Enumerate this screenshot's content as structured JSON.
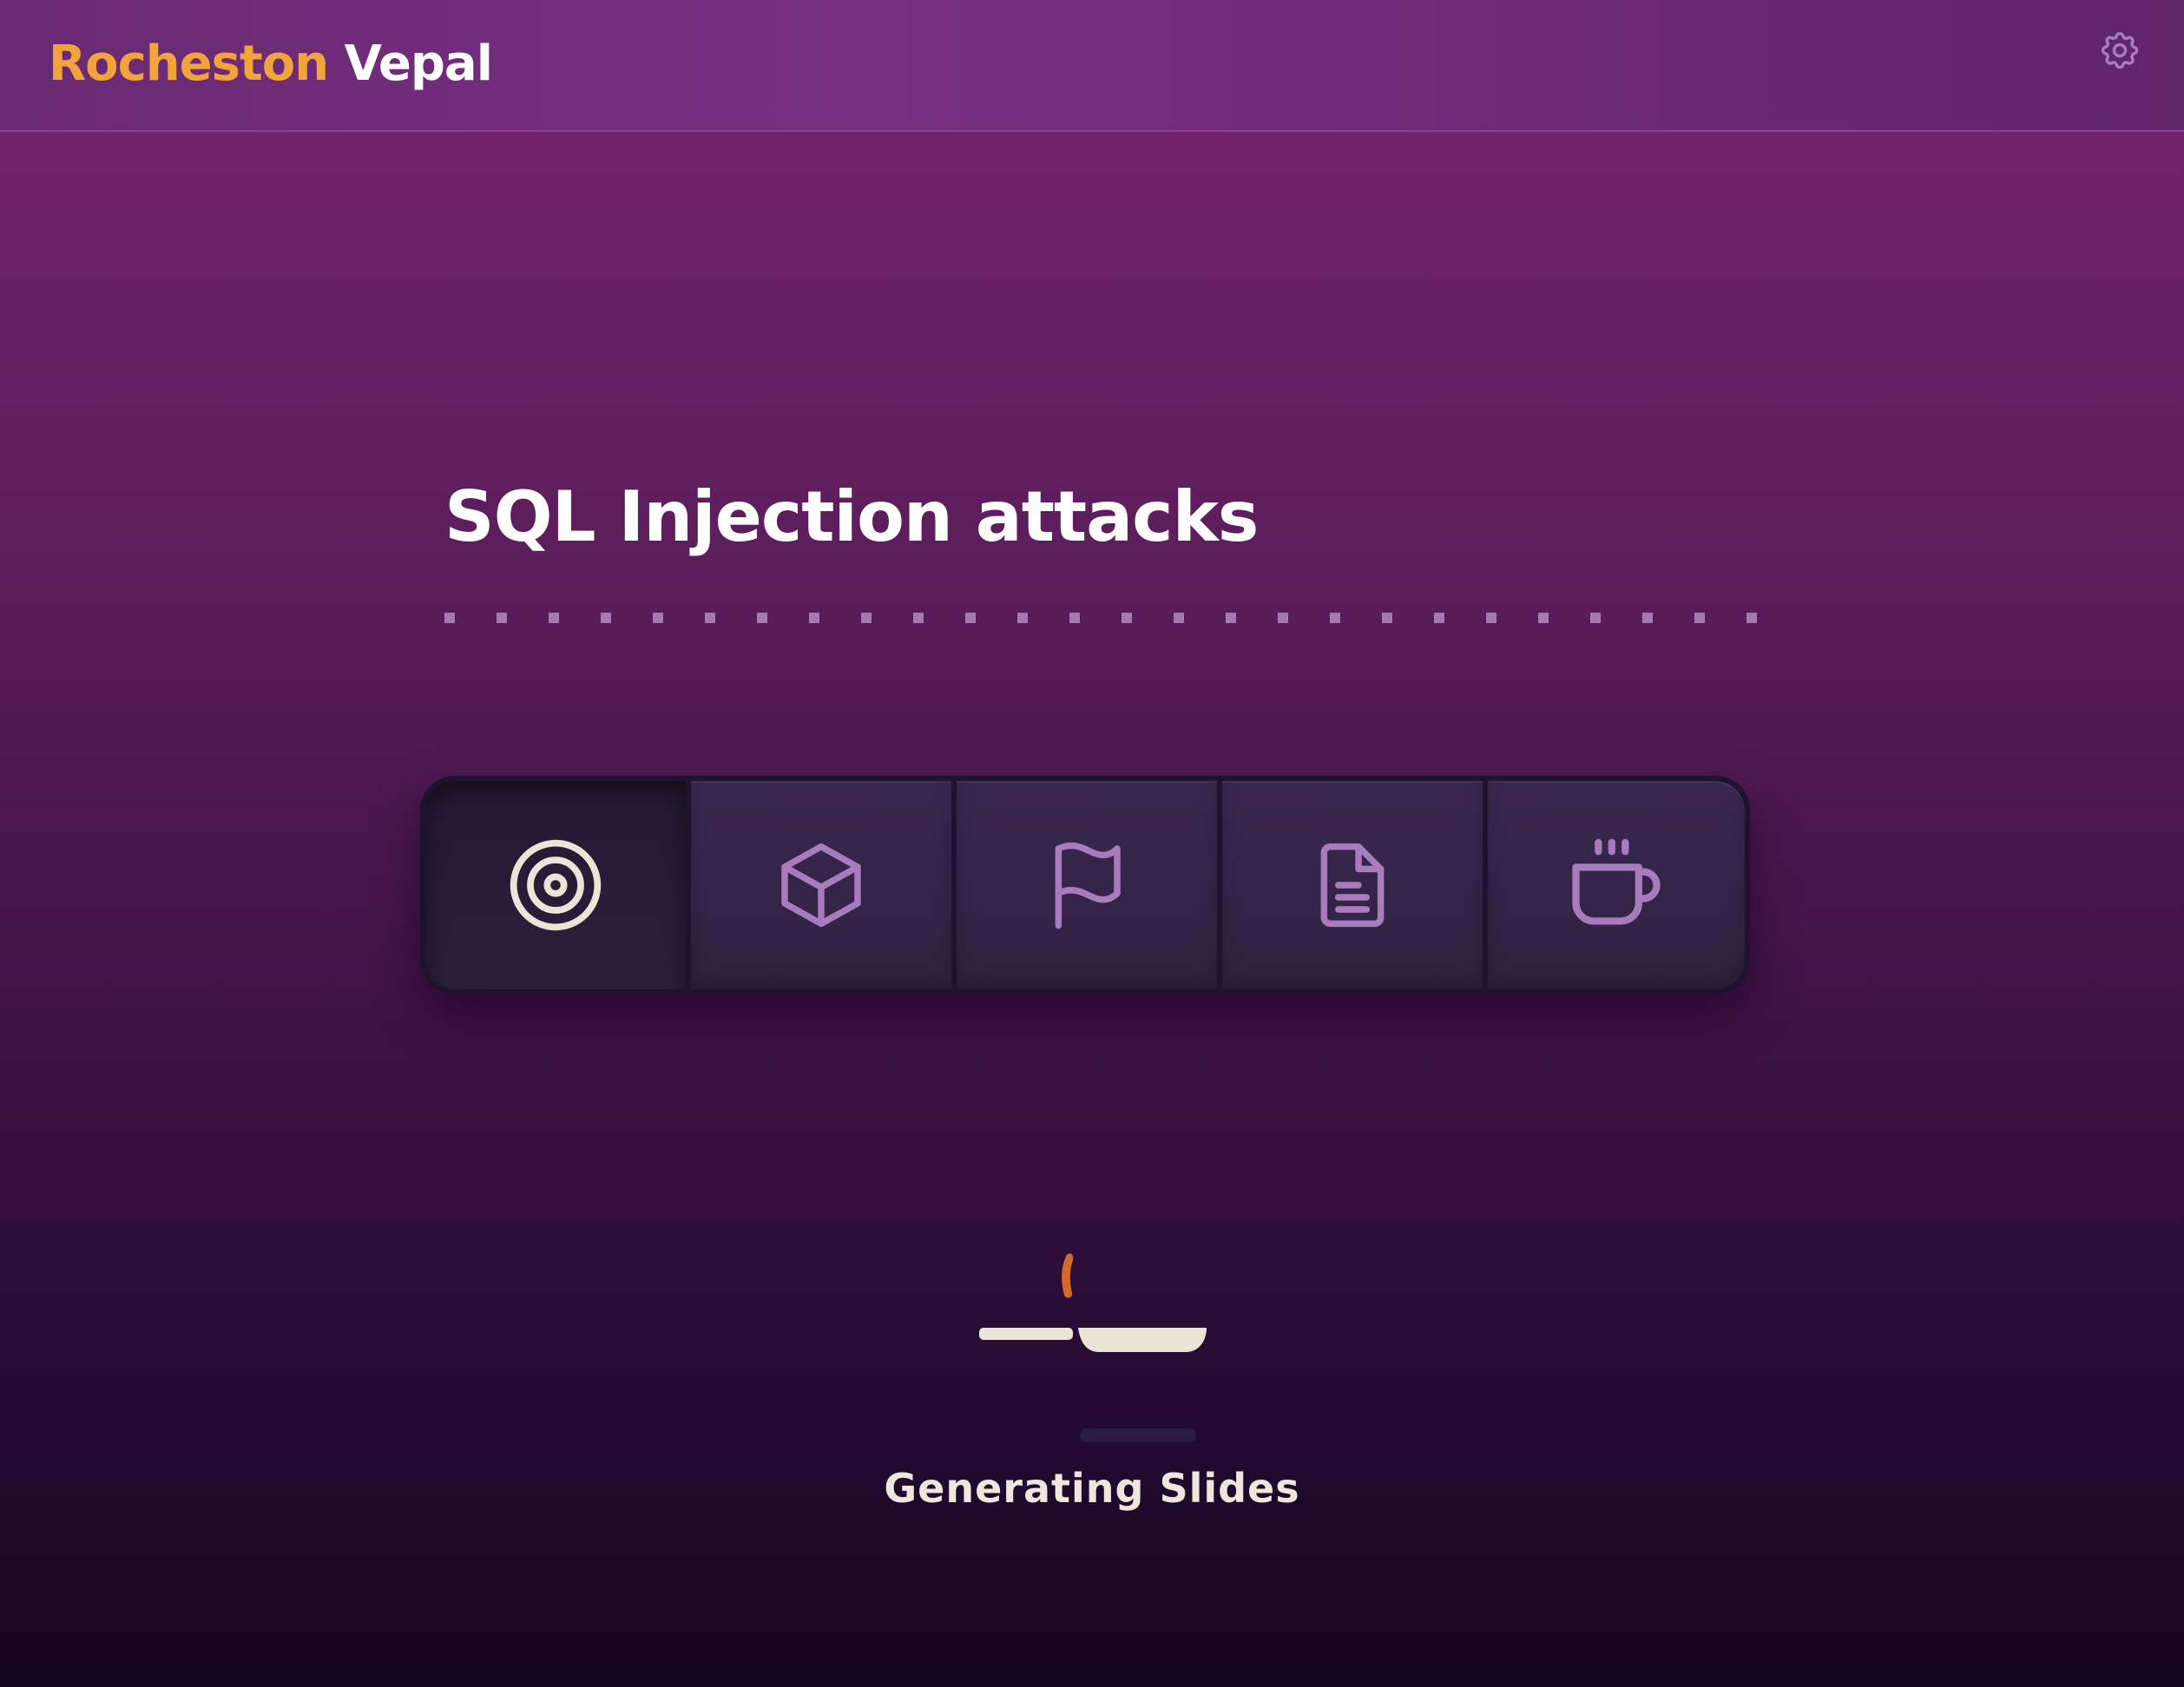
{
  "header": {
    "brand_first": "Rocheston",
    "brand_second": "Vepal",
    "settings_icon": "gear-icon"
  },
  "main": {
    "title": "SQL Injection attacks",
    "toolbar": [
      {
        "icon": "target-icon",
        "active": true
      },
      {
        "icon": "cube-icon",
        "active": false
      },
      {
        "icon": "flag-icon",
        "active": false
      },
      {
        "icon": "document-icon",
        "active": false
      },
      {
        "icon": "coffee-cup-icon",
        "active": false
      }
    ],
    "loader_icon": "frying-pan-icon",
    "status": "Generating Slides"
  },
  "colors": {
    "brand_accent": "#f0a43a",
    "icon_inactive": "#a87bbd",
    "icon_active": "#ece4d6",
    "loader_flame": "#d5692a"
  }
}
